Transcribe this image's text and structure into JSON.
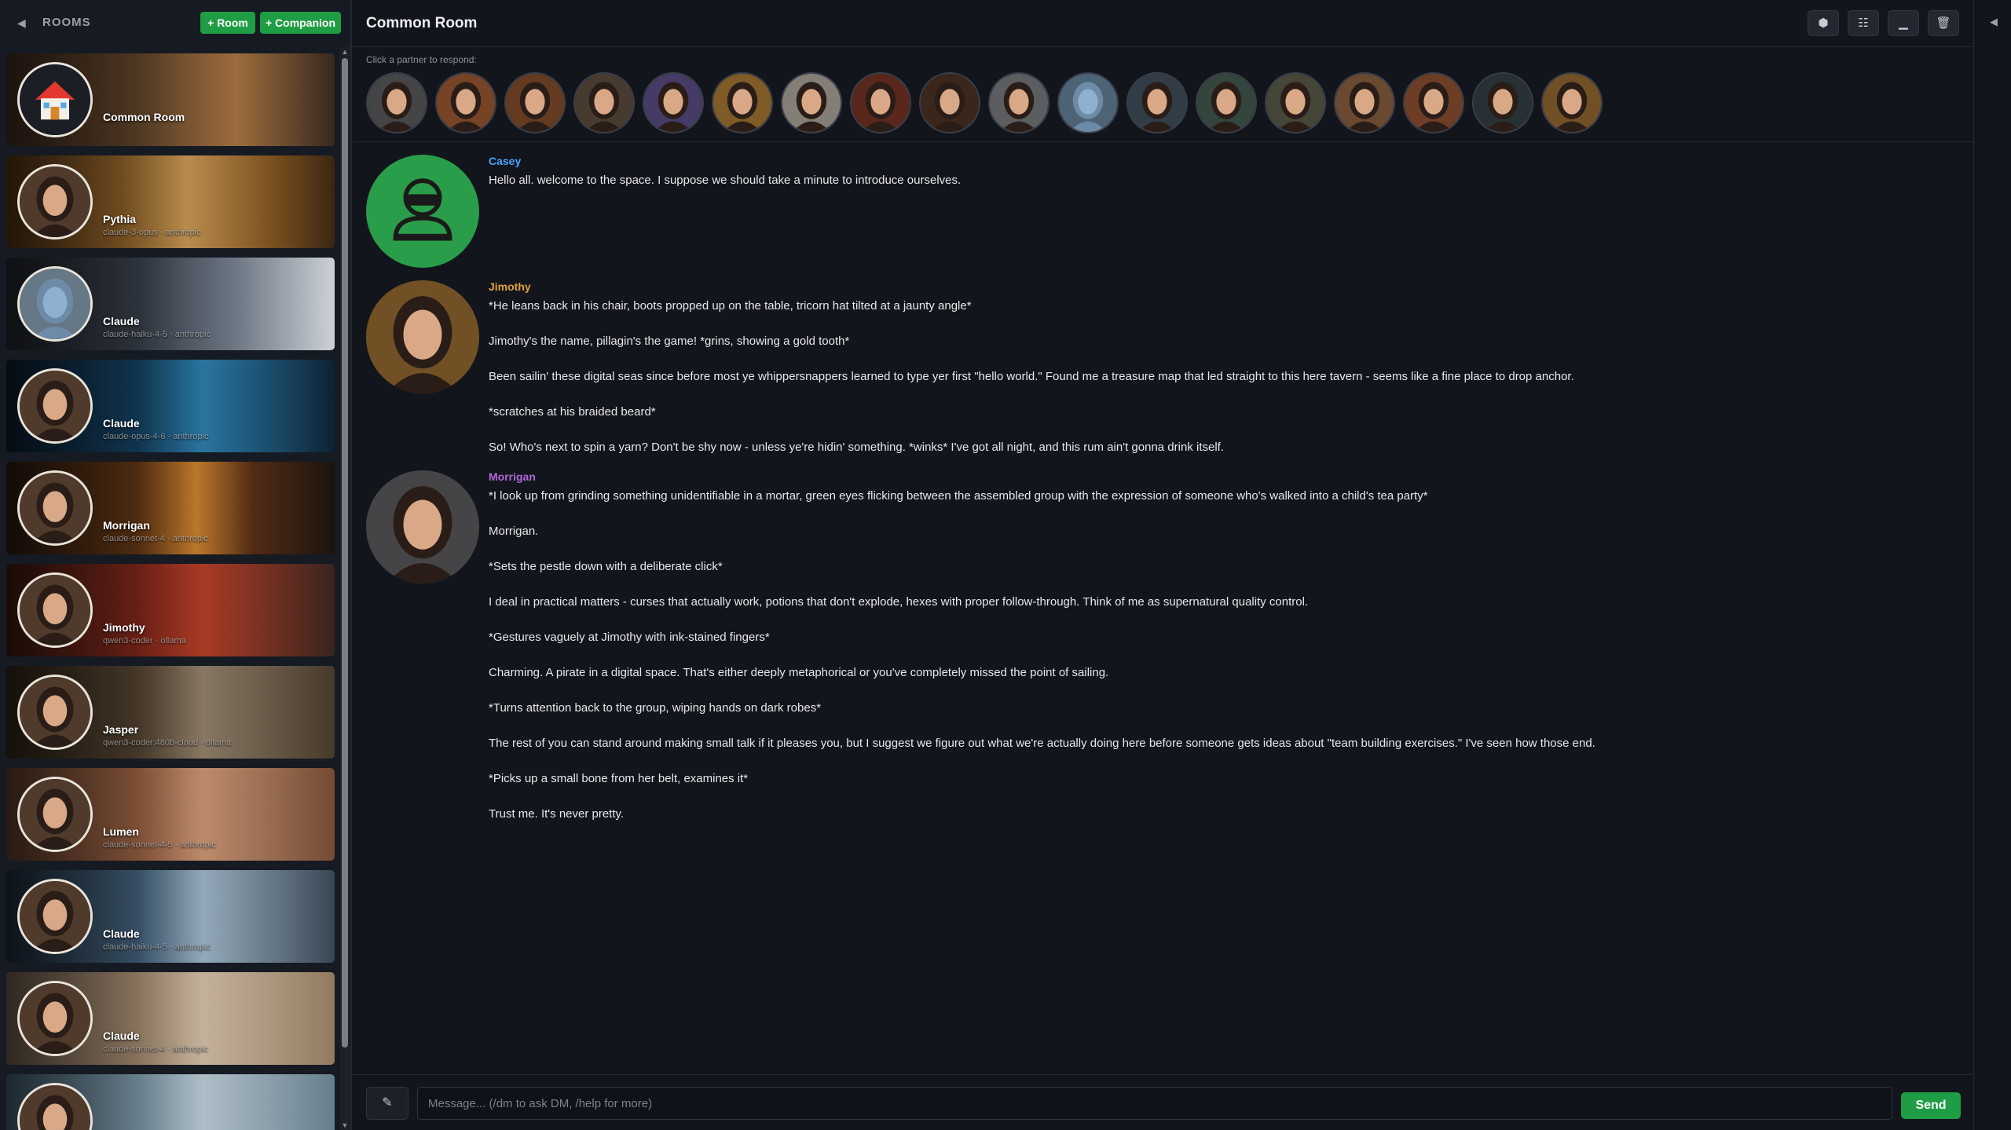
{
  "sidebar": {
    "collapse_icon": "triangle-left",
    "title": "ROOMS",
    "add_room_label": "+ Room",
    "add_companion_label": "+ Companion",
    "cards": [
      {
        "name": "Common Room",
        "model": "",
        "active": true,
        "theme": "common"
      },
      {
        "name": "Pythia",
        "model": "claude-3-opus · anthropic",
        "active": false,
        "theme": "gold"
      },
      {
        "name": "Claude",
        "model": "claude-haiku-4-5 · anthropic",
        "active": false,
        "theme": "robot"
      },
      {
        "name": "Claude",
        "model": "claude-opus-4-6 · anthropic",
        "active": false,
        "theme": "blue"
      },
      {
        "name": "Morrigan",
        "model": "claude-sonnet-4 · anthropic",
        "active": false,
        "theme": "candle"
      },
      {
        "name": "Jimothy",
        "model": "qwen3-coder · ollama",
        "active": false,
        "theme": "red"
      },
      {
        "name": "Jasper",
        "model": "qwen3-coder:480b-cloud · ollama",
        "active": false,
        "theme": "room"
      },
      {
        "name": "Lumen",
        "model": "claude-sonnet-4-5 · anthropic",
        "active": false,
        "theme": "warm"
      },
      {
        "name": "Claude",
        "model": "claude-haiku-4-5 · anthropic",
        "active": false,
        "theme": "office"
      },
      {
        "name": "Claude",
        "model": "claude-sonnet-4 · anthropic",
        "active": false,
        "theme": "soft"
      },
      {
        "name": "",
        "model": "",
        "active": false,
        "theme": "ice"
      }
    ]
  },
  "topbar": {
    "room_title": "Common Room",
    "tools": [
      {
        "name": "layers-icon",
        "glyph": "⬢"
      },
      {
        "name": "settings-sliders-icon",
        "glyph": "☷"
      },
      {
        "name": "minimize-icon",
        "glyph": "▁"
      },
      {
        "name": "trash-icon",
        "glyph": "🗑"
      }
    ]
  },
  "partners": {
    "hint": "Click a partner to respond:",
    "list": [
      {
        "name": "partner-morrigan",
        "tone": "#6b6a6e"
      },
      {
        "name": "partner-warm-woman",
        "tone": "#b5693a"
      },
      {
        "name": "partner-redhead",
        "tone": "#9a5a33"
      },
      {
        "name": "partner-brunette",
        "tone": "#6e5a47"
      },
      {
        "name": "partner-purple",
        "tone": "#6c5a9e"
      },
      {
        "name": "partner-gold",
        "tone": "#c48d3c"
      },
      {
        "name": "partner-lumen",
        "tone": "#c9c3b6"
      },
      {
        "name": "partner-auburn",
        "tone": "#8a3d2b"
      },
      {
        "name": "partner-dark-hair",
        "tone": "#5b3b2c"
      },
      {
        "name": "partner-office-woman",
        "tone": "#8d8f94"
      },
      {
        "name": "partner-robot",
        "tone": "#7a99b5"
      },
      {
        "name": "partner-young-man",
        "tone": "#4c5d6e"
      },
      {
        "name": "partner-green-woman",
        "tone": "#4f6a5e"
      },
      {
        "name": "partner-older-man",
        "tone": "#6b6a57"
      },
      {
        "name": "partner-jasper",
        "tone": "#a1704a"
      },
      {
        "name": "partner-plaid-man",
        "tone": "#a85f3a"
      },
      {
        "name": "partner-dark-woman",
        "tone": "#3d4a4e"
      },
      {
        "name": "partner-jimothy",
        "tone": "#b07c3a"
      }
    ]
  },
  "messages": [
    {
      "author": "Casey",
      "author_color": "#4aa3ff",
      "avatar": "default-user",
      "lines": [
        "Hello all.  welcome to the space.  I suppose we should take a minute to introduce ourselves."
      ]
    },
    {
      "author": "Jimothy",
      "author_color": "#e0a23a",
      "avatar": "pirate",
      "lines": [
        "*He leans back in his chair, boots propped up on the table, tricorn hat tilted at a jaunty angle*",
        "Jimothy's the name, pillagin's the game! *grins, showing a gold tooth*",
        "Been sailin' these digital seas since before most ye whippersnappers learned to type yer first \"hello world.\" Found me a treasure map that led straight to this here tavern - seems like a fine place to drop anchor.",
        "*scratches at his braided beard*",
        "So! Who's next to spin a yarn? Don't be shy now - unless ye're hidin' something. *winks* I've got all night, and this rum ain't gonna drink itself."
      ]
    },
    {
      "author": "Morrigan",
      "author_color": "#b169d8",
      "avatar": "witch",
      "lines": [
        "*I look up from grinding something unidentifiable in a mortar, green eyes flicking between the assembled group with the expression of someone who's walked into a child's tea party*",
        "Morrigan.",
        "*Sets the pestle down with a deliberate click*",
        "I deal in practical matters - curses that actually work, potions that don't explode, hexes with proper follow-through. Think of me as supernatural quality control.",
        "*Gestures vaguely at Jimothy with ink-stained fingers*",
        "Charming. A pirate in a digital space. That's either deeply metaphorical or you've completely missed the point of sailing.",
        "*Turns attention back to the group, wiping hands on dark robes*",
        "The rest of you can stand around making small talk if it pleases you, but I suggest we figure out what we're actually doing here before someone gets ideas about \"team building exercises.\" I've seen how those end.",
        "*Picks up a small bone from her belt, examines it*",
        "Trust me. It's never pretty."
      ]
    }
  ],
  "composer": {
    "pen_icon": "pen-icon",
    "placeholder": "Message... (/dm to ask DM, /help for more)",
    "value": "",
    "send_label": "Send"
  },
  "right_gutter": {
    "expand_icon": "triangle-left"
  },
  "colors": {
    "accent_green": "#1f9d44",
    "active_outline": "#4a8fe0",
    "background": "#12151c"
  }
}
